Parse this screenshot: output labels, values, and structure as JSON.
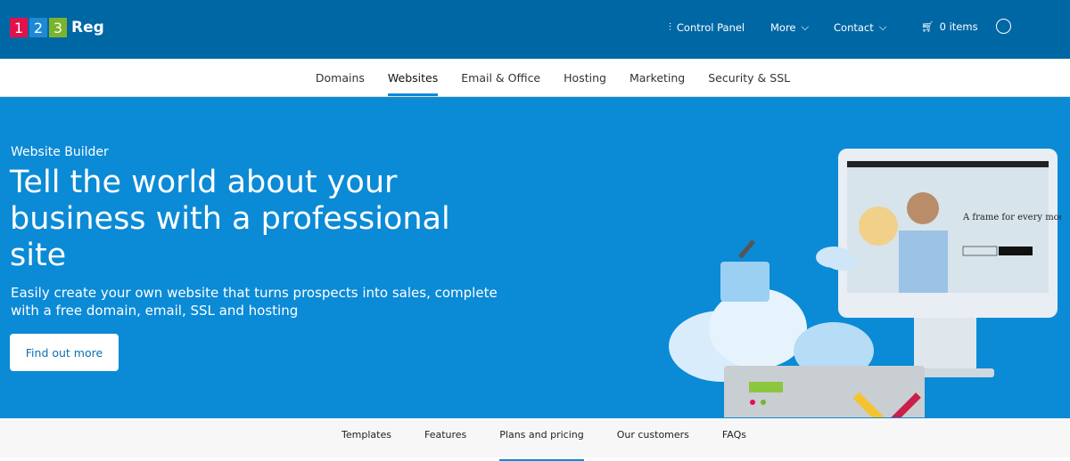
{
  "header": {
    "logo": {
      "d1": "1",
      "d2": "2",
      "d3": "3",
      "text": "Reg"
    },
    "control_panel": "Control Panel",
    "more": "More",
    "contact": "Contact",
    "cart": "0 items"
  },
  "main_nav": [
    {
      "label": "Domains"
    },
    {
      "label": "Websites",
      "active": true
    },
    {
      "label": "Email & Office"
    },
    {
      "label": "Hosting"
    },
    {
      "label": "Marketing"
    },
    {
      "label": "Security & SSL"
    }
  ],
  "hero": {
    "eyebrow": "Website Builder",
    "title": "Tell the world about your business with a professional site",
    "subtitle": "Easily create your own website that turns prospects into sales, complete with a free domain, email, SSL and hosting",
    "cta": "Find out more",
    "screen_headline": "A frame for every mood!"
  },
  "sub_nav": [
    {
      "label": "Templates"
    },
    {
      "label": "Features"
    },
    {
      "label": "Plans and pricing",
      "active": true
    },
    {
      "label": "Our customers"
    },
    {
      "label": "FAQs"
    }
  ],
  "colors": {
    "header": "#0067a5",
    "hero": "#0b8ad6",
    "logo_red": "#e2114b",
    "logo_blue": "#1e8ad6",
    "logo_green": "#7ab42c"
  }
}
